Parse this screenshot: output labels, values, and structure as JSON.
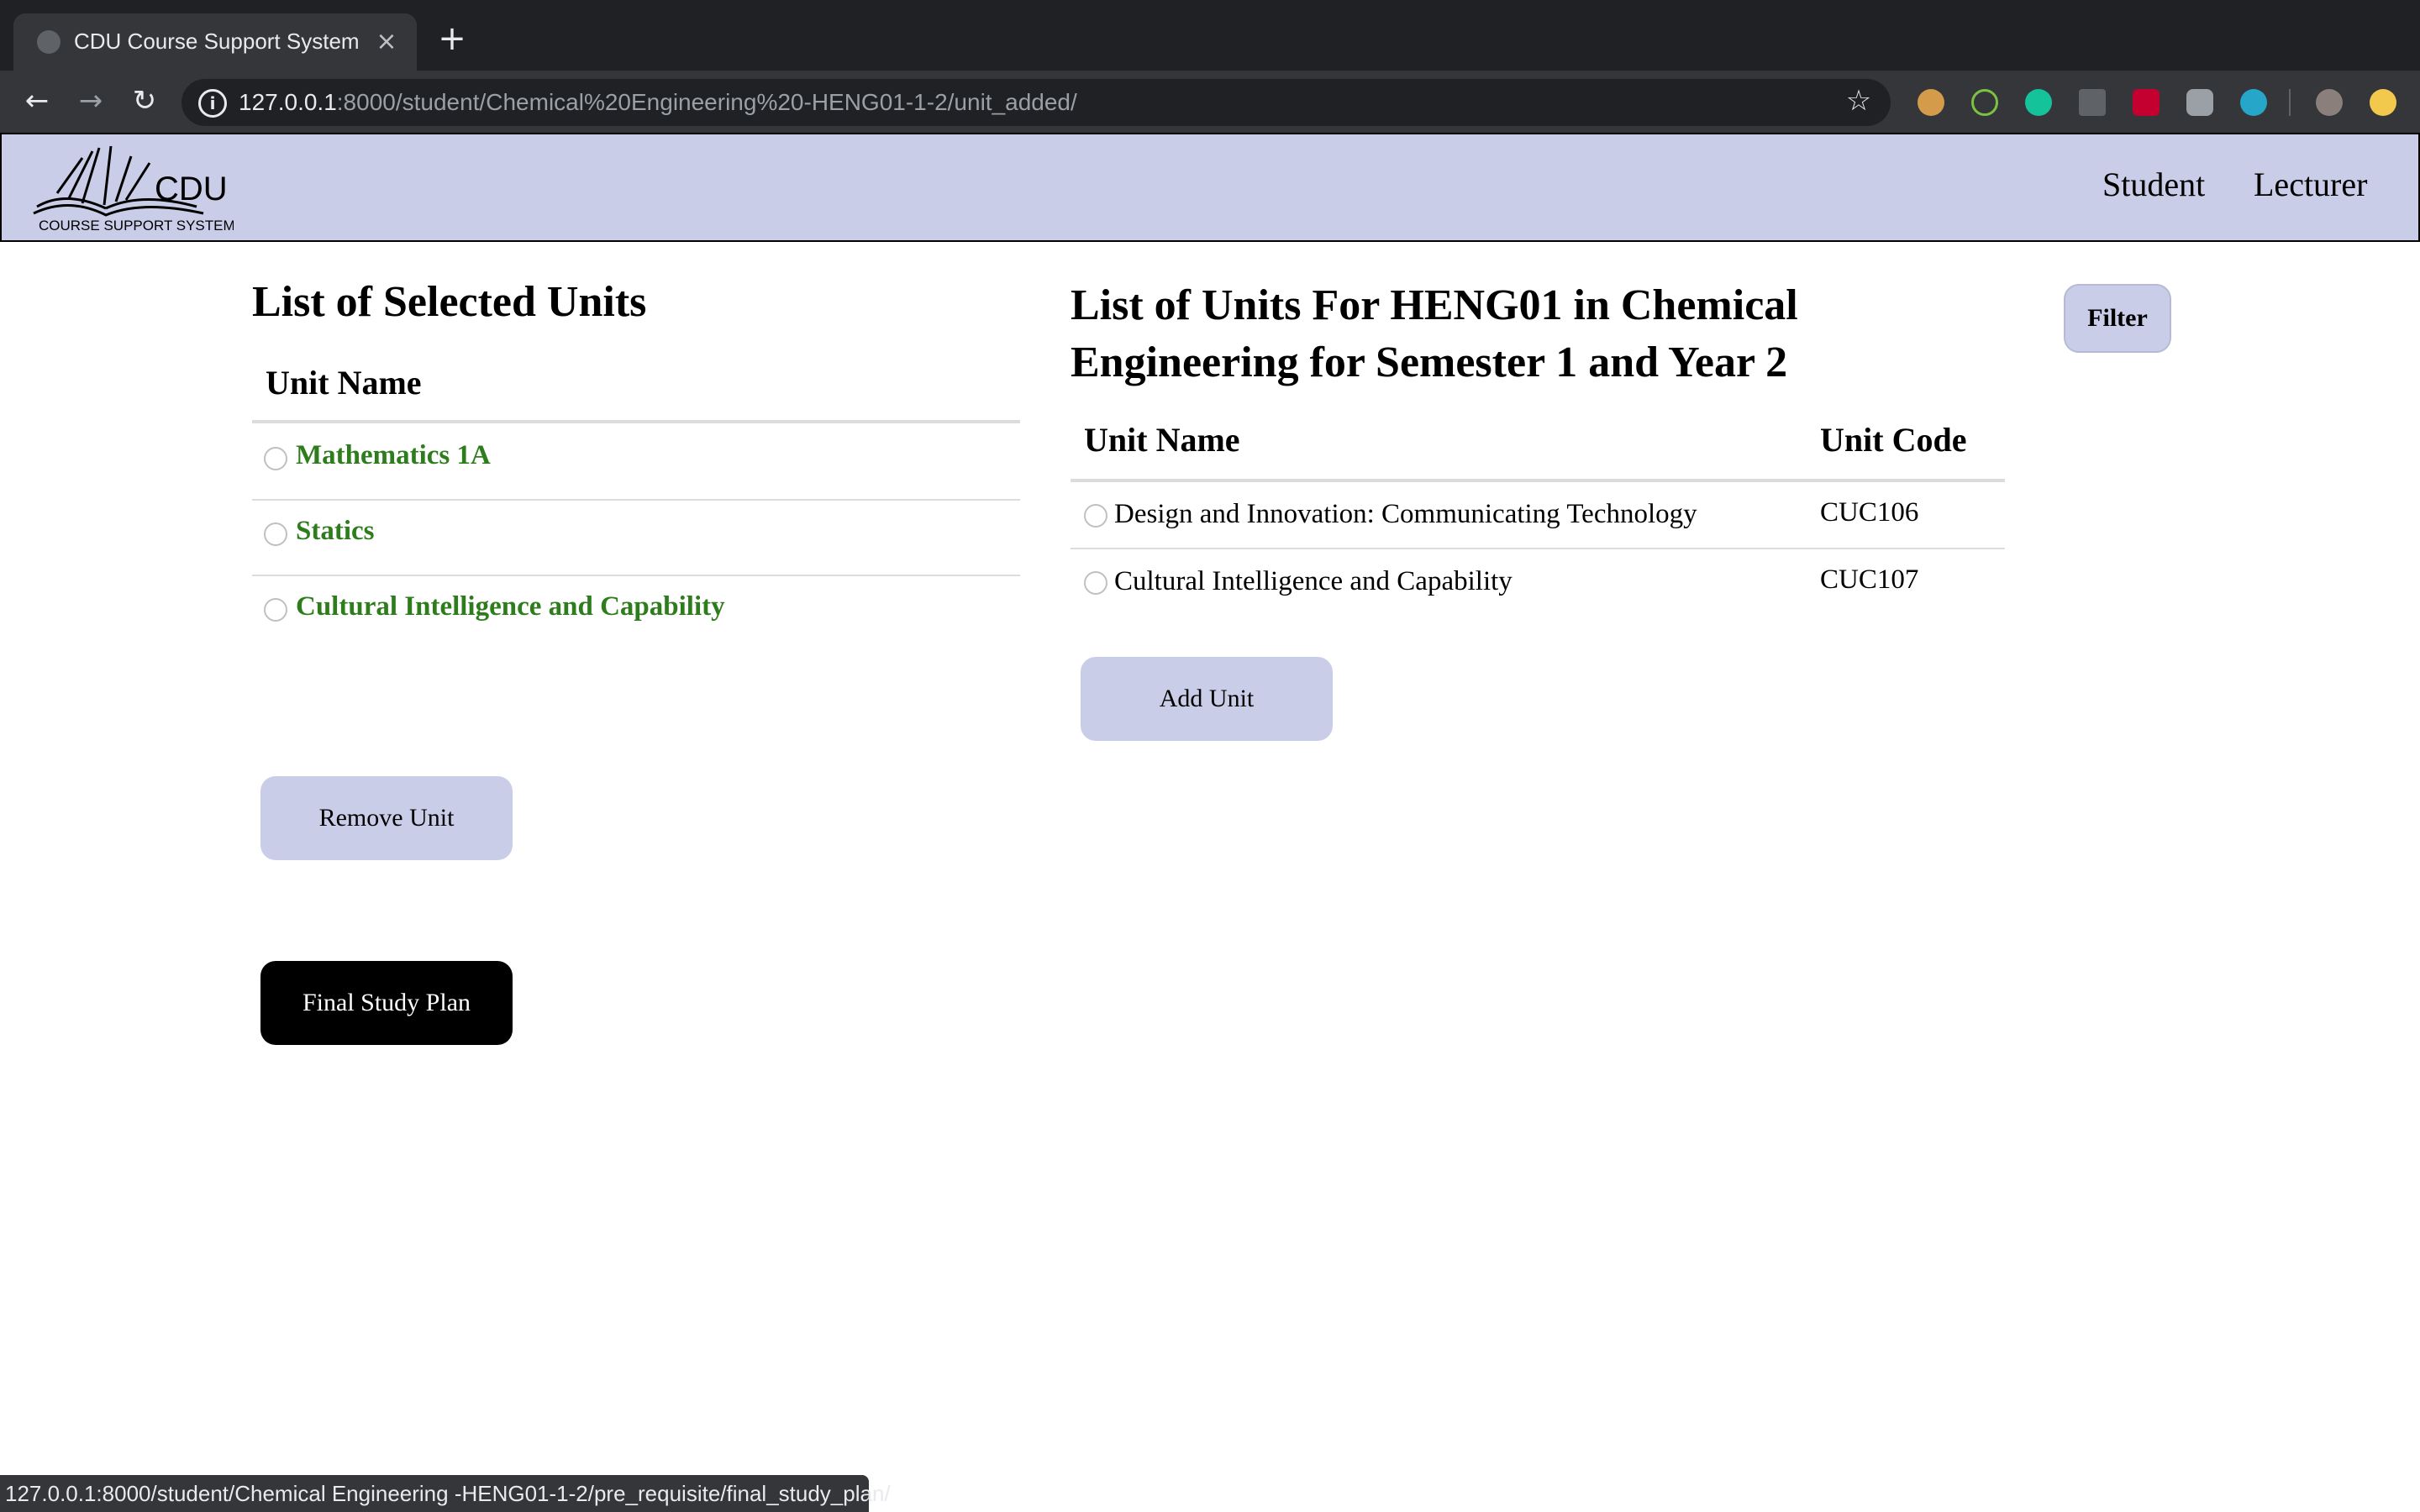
{
  "browser": {
    "tab_title": "CDU Course Support System",
    "url_host": "127.0.0.1",
    "url_rest": ":8000/student/Chemical%20Engineering%20-HENG01-1-2/unit_added/",
    "status_url": "127.0.0.1:8000/student/Chemical Engineering -HENG01-1-2/pre_requisite/final_study_plan/"
  },
  "navbar": {
    "logo_text": "CDU",
    "logo_subtext": "COURSE SUPPORT SYSTEM",
    "links": [
      "Student",
      "Lecturer"
    ]
  },
  "selected": {
    "heading": "List of Selected Units",
    "column": "Unit Name",
    "units": [
      "Mathematics 1A",
      "Statics",
      "Cultural Intelligence and Capability"
    ],
    "remove_label": "Remove Unit",
    "final_label": "Final Study Plan"
  },
  "available": {
    "heading": "List of Units For HENG01 in Chemical Engineering for Semester 1 and Year 2",
    "columns": [
      "Unit Name",
      "Unit Code"
    ],
    "units": [
      {
        "name": "Design and Innovation: Communicating Technology",
        "code": "CUC106"
      },
      {
        "name": "Cultural Intelligence and Capability",
        "code": "CUC107"
      }
    ],
    "add_label": "Add Unit",
    "filter_label": "Filter"
  },
  "colors": {
    "navbar_bg": "#c9cde8",
    "selected_text": "#2e7d1d",
    "dark_button": "#000000"
  }
}
